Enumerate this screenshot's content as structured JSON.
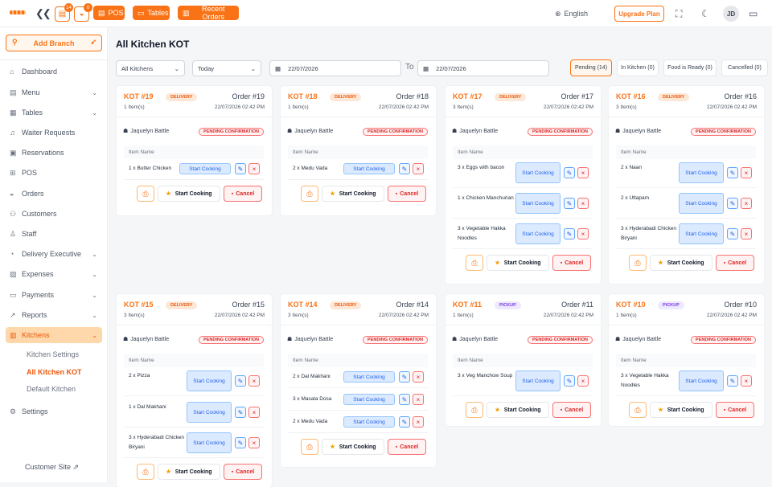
{
  "topbar": {
    "pos_label": "POS",
    "tables_label": "Tables",
    "recent_orders_label": "Recent Orders",
    "badge_kot": "14",
    "badge_waiter": "0",
    "language": "English",
    "upgrade_label": "Upgrade Plan",
    "avatar_initials": "JD"
  },
  "sidebar": {
    "add_branch": "Add Branch",
    "items": [
      {
        "label": "Dashboard",
        "icon": "home-icon",
        "glyph": "⌂",
        "chev": false,
        "active": false
      },
      {
        "label": "Menu",
        "icon": "menu-book-icon",
        "glyph": "▤",
        "chev": true,
        "active": false
      },
      {
        "label": "Tables",
        "icon": "table-icon",
        "glyph": "▦",
        "chev": true,
        "active": false
      },
      {
        "label": "Waiter Requests",
        "icon": "bell-icon",
        "glyph": "♫",
        "chev": false,
        "active": false
      },
      {
        "label": "Reservations",
        "icon": "calendar-icon",
        "glyph": "▣",
        "chev": false,
        "active": false
      },
      {
        "label": "POS",
        "icon": "pos-icon",
        "glyph": "⊞",
        "chev": false,
        "active": false
      },
      {
        "label": "Orders",
        "icon": "orders-icon",
        "glyph": "◒",
        "chev": false,
        "active": false
      },
      {
        "label": "Customers",
        "icon": "users-icon",
        "glyph": "⚇",
        "chev": false,
        "active": false
      },
      {
        "label": "Staff",
        "icon": "staff-icon",
        "glyph": "♙",
        "chev": false,
        "active": false
      },
      {
        "label": "Delivery Executive",
        "icon": "delivery-icon",
        "glyph": "◔",
        "chev": true,
        "active": false
      },
      {
        "label": "Expenses",
        "icon": "expenses-icon",
        "glyph": "▨",
        "chev": true,
        "active": false
      },
      {
        "label": "Payments",
        "icon": "payments-icon",
        "glyph": "▭",
        "chev": true,
        "active": false
      },
      {
        "label": "Reports",
        "icon": "chart-icon",
        "glyph": "↗",
        "chev": true,
        "active": false
      },
      {
        "label": "Kitchens",
        "icon": "kitchen-icon",
        "glyph": "▥",
        "chev": true,
        "active": true
      }
    ],
    "subitems": [
      "Kitchen Settings",
      "All Kitchen KOT",
      "Default Kitchen"
    ],
    "settings": "Settings",
    "customer_site": "Customer Site"
  },
  "page": {
    "title": "All Kitchen KOT",
    "kitchen_filter": "All Kitchens",
    "date_range": "Today",
    "date_from": "22/07/2026",
    "date_to": "22/07/2026",
    "to_label": "To",
    "tabs": [
      "Pending (14)",
      "In Kitchen (0)",
      "Food is Ready (0)",
      "Cancelled (0)"
    ]
  },
  "labels": {
    "item_name": "Item Name",
    "start_cooking": "Start Cooking",
    "cancel": "Cancel",
    "status": "PENDING CONFIRMATION"
  },
  "kots": [
    {
      "kot": "KOT #19",
      "type": "DELIVERY",
      "order": "Order #19",
      "items": "1 Item(s)",
      "time": "22/07/2026 02:42 PM",
      "waiter": "Jaquelyn Battle",
      "lines": [
        "1 x Butter Chicken"
      ]
    },
    {
      "kot": "KOT #18",
      "type": "DELIVERY",
      "order": "Order #18",
      "items": "1 Item(s)",
      "time": "22/07/2026 02:42 PM",
      "waiter": "Jaquelyn Battle",
      "lines": [
        "2 x Medu Vada"
      ]
    },
    {
      "kot": "KOT #17",
      "type": "DELIVERY",
      "order": "Order #17",
      "items": "3 Item(s)",
      "time": "22/07/2026 02:42 PM",
      "waiter": "Jaquelyn Battle",
      "lines": [
        "3 x Eggs with bacon",
        "1 x Chicken Manchurian",
        "3 x Vegetable Hakka Noodles"
      ]
    },
    {
      "kot": "KOT #16",
      "type": "DELIVERY",
      "order": "Order #16",
      "items": "3 Item(s)",
      "time": "22/07/2026 02:42 PM",
      "waiter": "Jaquelyn Battle",
      "lines": [
        "2 x Naan",
        "2 x Uttapam",
        "3 x Hyderabadi Chicken Biryani"
      ]
    },
    {
      "kot": "KOT #15",
      "type": "DELIVERY",
      "order": "Order #15",
      "items": "3 Item(s)",
      "time": "22/07/2026 02:42 PM",
      "waiter": "Jaquelyn Battle",
      "lines": [
        "2 x Pizza",
        "1 x Dal Makhani",
        "3 x Hyderabadi Chicken Biryani"
      ]
    },
    {
      "kot": "KOT #14",
      "type": "DELIVERY",
      "order": "Order #14",
      "items": "3 Item(s)",
      "time": "22/07/2026 02:42 PM",
      "waiter": "Jaquelyn Battle",
      "lines": [
        "2 x Dal Makhani",
        "3 x Masala Dosa",
        "2 x Medu Vada"
      ]
    },
    {
      "kot": "KOT #11",
      "type": "PICKUP",
      "order": "Order #11",
      "items": "1 Item(s)",
      "time": "22/07/2026 02:42 PM",
      "waiter": "Jaquelyn Battle",
      "lines": [
        "3 x Veg Manchow Soup"
      ]
    },
    {
      "kot": "KOT #10",
      "type": "PICKUP",
      "order": "Order #10",
      "items": "1 Item(s)",
      "time": "22/07/2026 02:42 PM",
      "waiter": "Jaquelyn Battle",
      "lines": [
        "3 x Vegetable Hakka Noodles"
      ]
    }
  ]
}
